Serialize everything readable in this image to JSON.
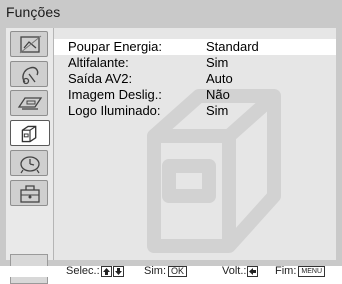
{
  "menu": {
    "title": "Funções"
  },
  "sidebar": {
    "tabs": [
      {
        "icon": "picture-adjust-icon"
      },
      {
        "icon": "sound-icon"
      },
      {
        "icon": "screen-control-icon"
      },
      {
        "icon": "features-icon",
        "active": true
      },
      {
        "icon": "timer-icon"
      },
      {
        "icon": "setup-toolbox-icon"
      }
    ]
  },
  "options": [
    {
      "name": "Poupar Energia:",
      "value": "Standard",
      "selected": true
    },
    {
      "name": "Altifalante:",
      "value": "Sim"
    },
    {
      "name": "Saída AV2:",
      "value": "Auto"
    },
    {
      "name": "Imagem Deslig.:",
      "value": "Não"
    },
    {
      "name": "Logo Iluminado:",
      "value": "Sim"
    }
  ],
  "hints": {
    "select_label": "Selec.:",
    "enter_label": "Sim:",
    "enter_key": "OK",
    "back_label": "Volt.:",
    "exit_label": "Fim:",
    "exit_key": "MENU"
  },
  "colors": {
    "frame": "#c9c9c9",
    "content": "#e6e6e6",
    "highlight": "#ffffff",
    "watermark": "#d2d2d2"
  }
}
